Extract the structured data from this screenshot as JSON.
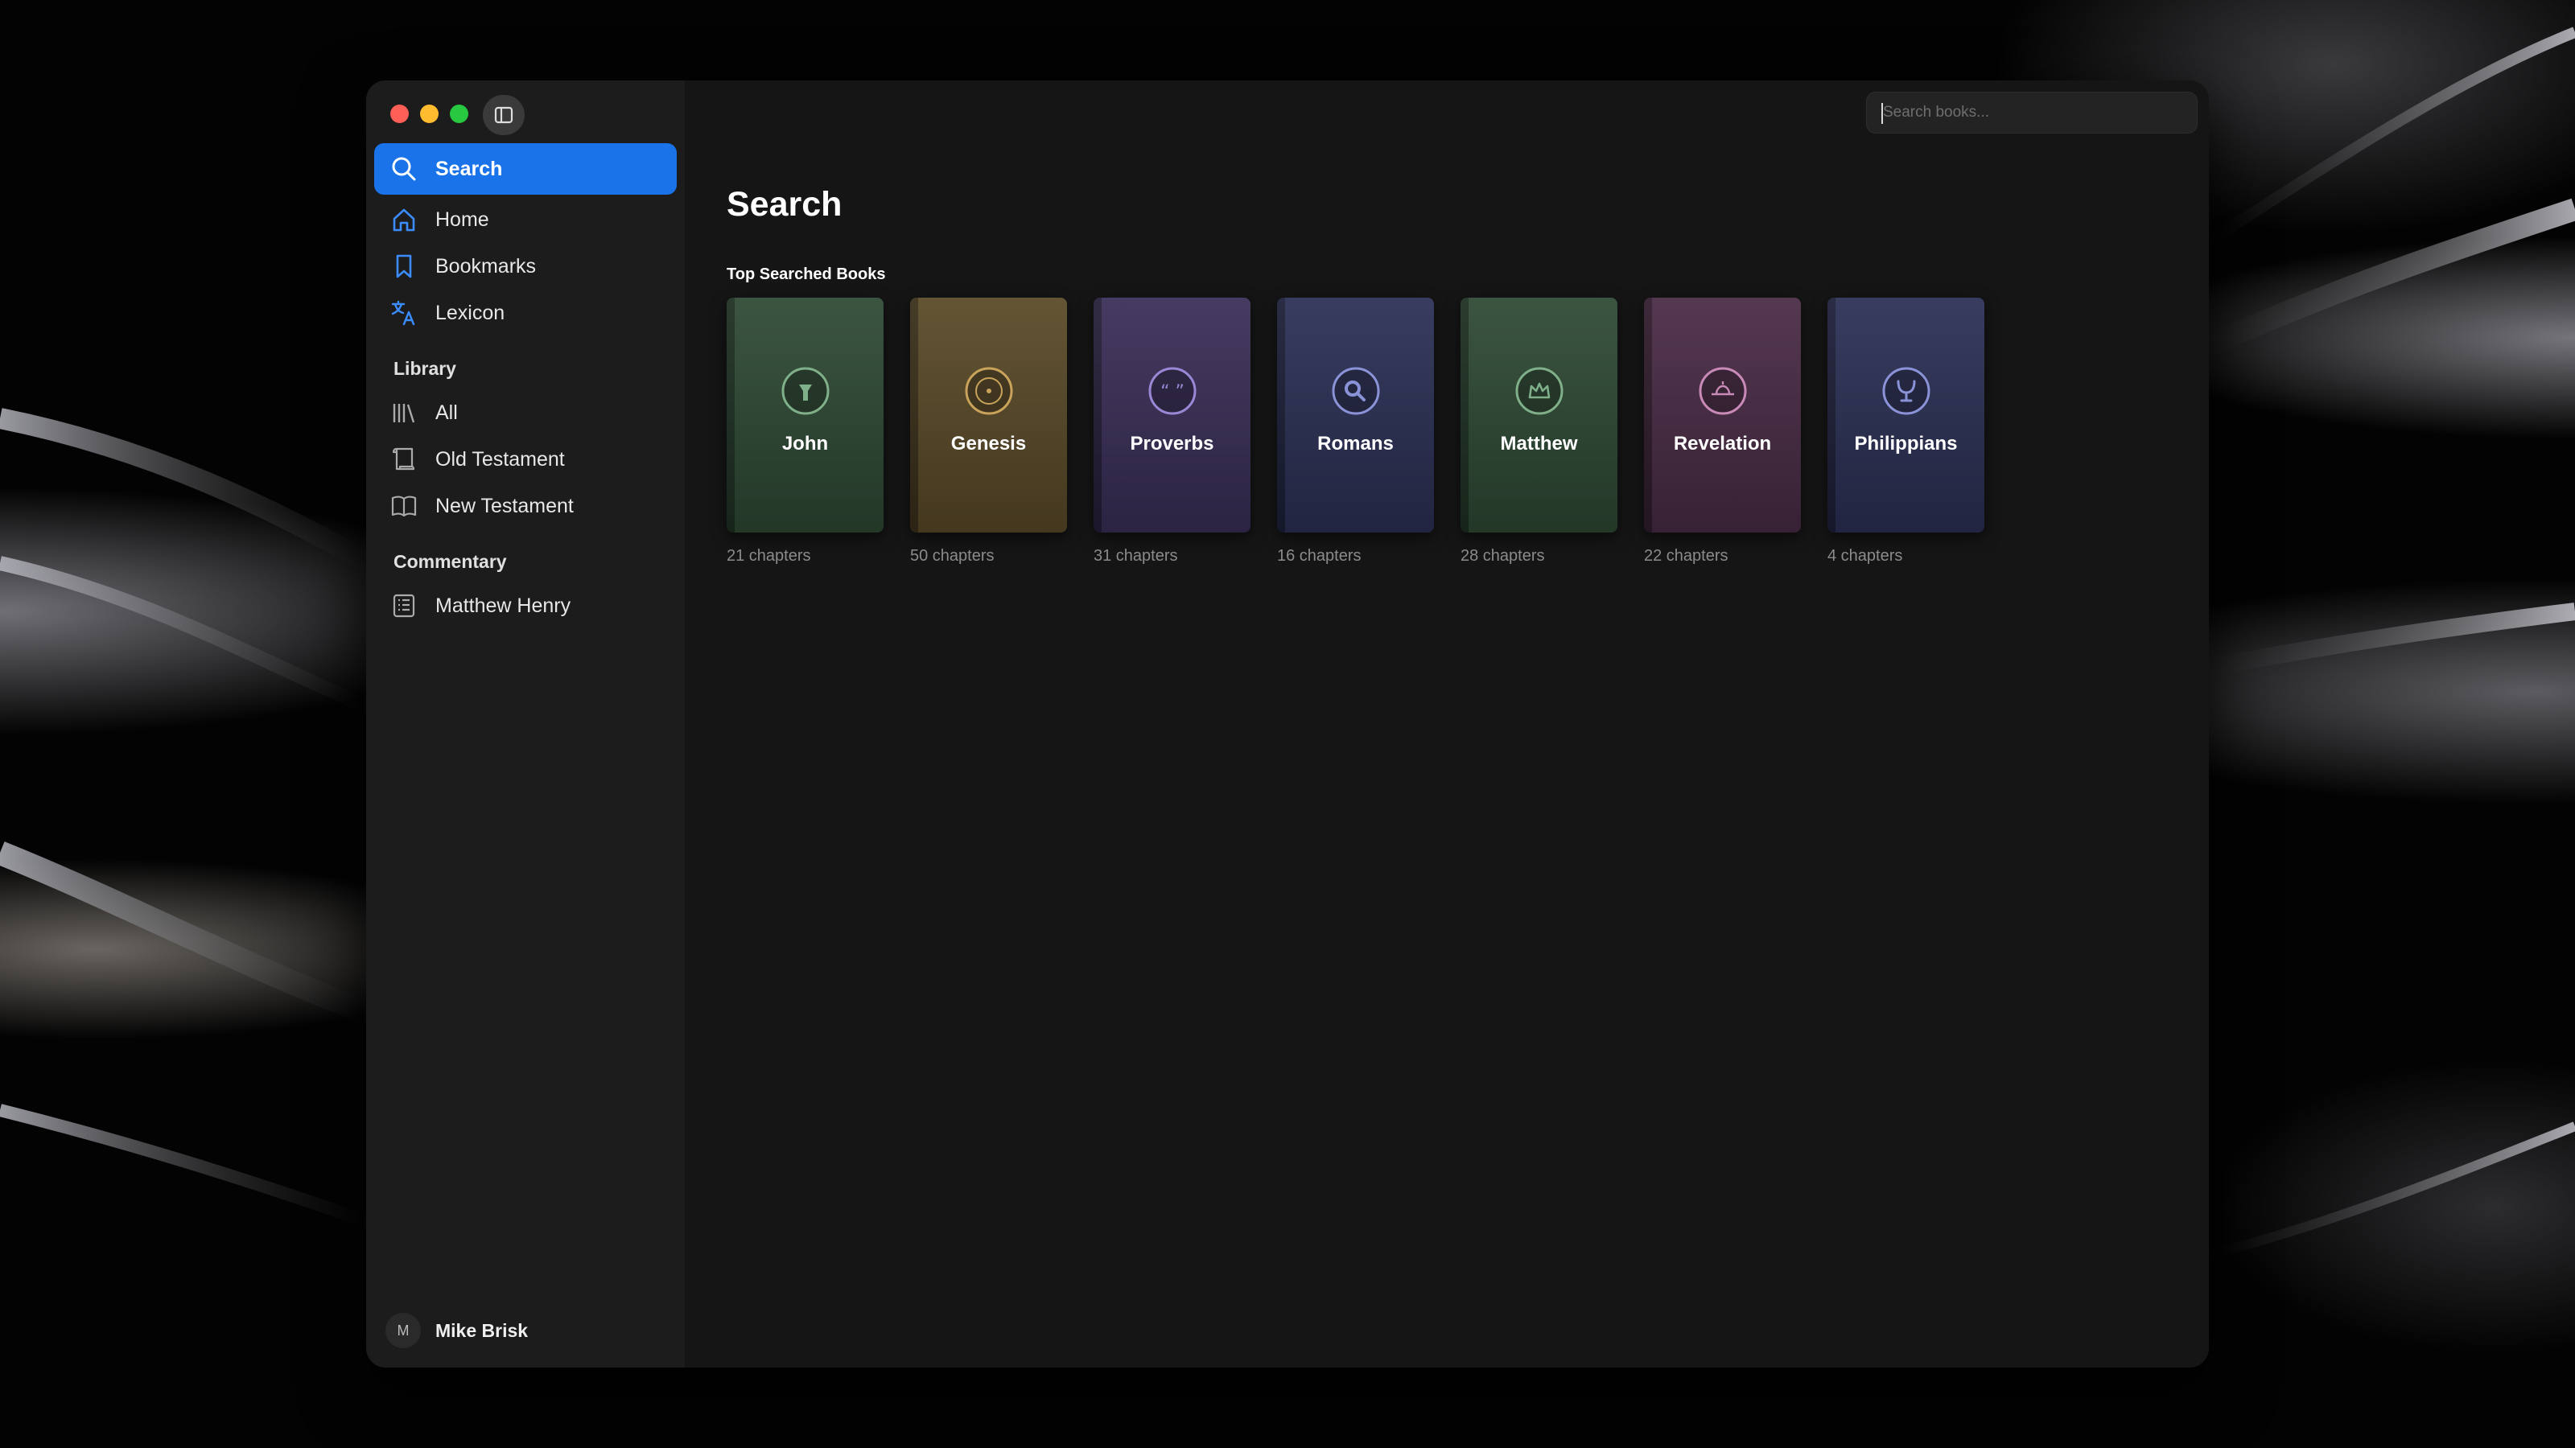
{
  "search": {
    "placeholder": "Search books..."
  },
  "sidebar": {
    "nav": [
      {
        "label": "Search",
        "icon": "magnifier-icon"
      },
      {
        "label": "Home",
        "icon": "house-icon"
      },
      {
        "label": "Bookmarks",
        "icon": "bookmark-icon"
      },
      {
        "label": "Lexicon",
        "icon": "translate-icon"
      }
    ],
    "library_title": "Library",
    "library": [
      {
        "label": "All",
        "icon": "books-icon"
      },
      {
        "label": "Old Testament",
        "icon": "scroll-icon"
      },
      {
        "label": "New Testament",
        "icon": "open-book-icon"
      }
    ],
    "commentary_title": "Commentary",
    "commentary": [
      {
        "label": "Matthew Henry",
        "icon": "list-book-icon"
      }
    ],
    "user": {
      "initial": "M",
      "name": "Mike Brisk"
    }
  },
  "main": {
    "title": "Search",
    "section_label": "Top Searched Books",
    "books": [
      {
        "name": "John",
        "chapters": "21 chapters",
        "color": "#2f4a35",
        "accent": "#7fb08a"
      },
      {
        "name": "Genesis",
        "chapters": "50 chapters",
        "color": "#5a4a28",
        "accent": "#c9a35a"
      },
      {
        "name": "Proverbs",
        "chapters": "31 chapters",
        "color": "#3a2f58",
        "accent": "#9a88d6"
      },
      {
        "name": "Romans",
        "chapters": "16 chapters",
        "color": "#2c3156",
        "accent": "#8b93d8"
      },
      {
        "name": "Matthew",
        "chapters": "28 chapters",
        "color": "#2f4a35",
        "accent": "#7fb08a"
      },
      {
        "name": "Revelation",
        "chapters": "22 chapters",
        "color": "#4a2c46",
        "accent": "#c98ab8"
      },
      {
        "name": "Philippians",
        "chapters": "4 chapters",
        "color": "#2c3156",
        "accent": "#8b93d8"
      }
    ]
  },
  "colors": {
    "accent_blue": "#1a73e8",
    "window_bg": "#151515",
    "sidebar_bg": "#1c1c1c"
  }
}
